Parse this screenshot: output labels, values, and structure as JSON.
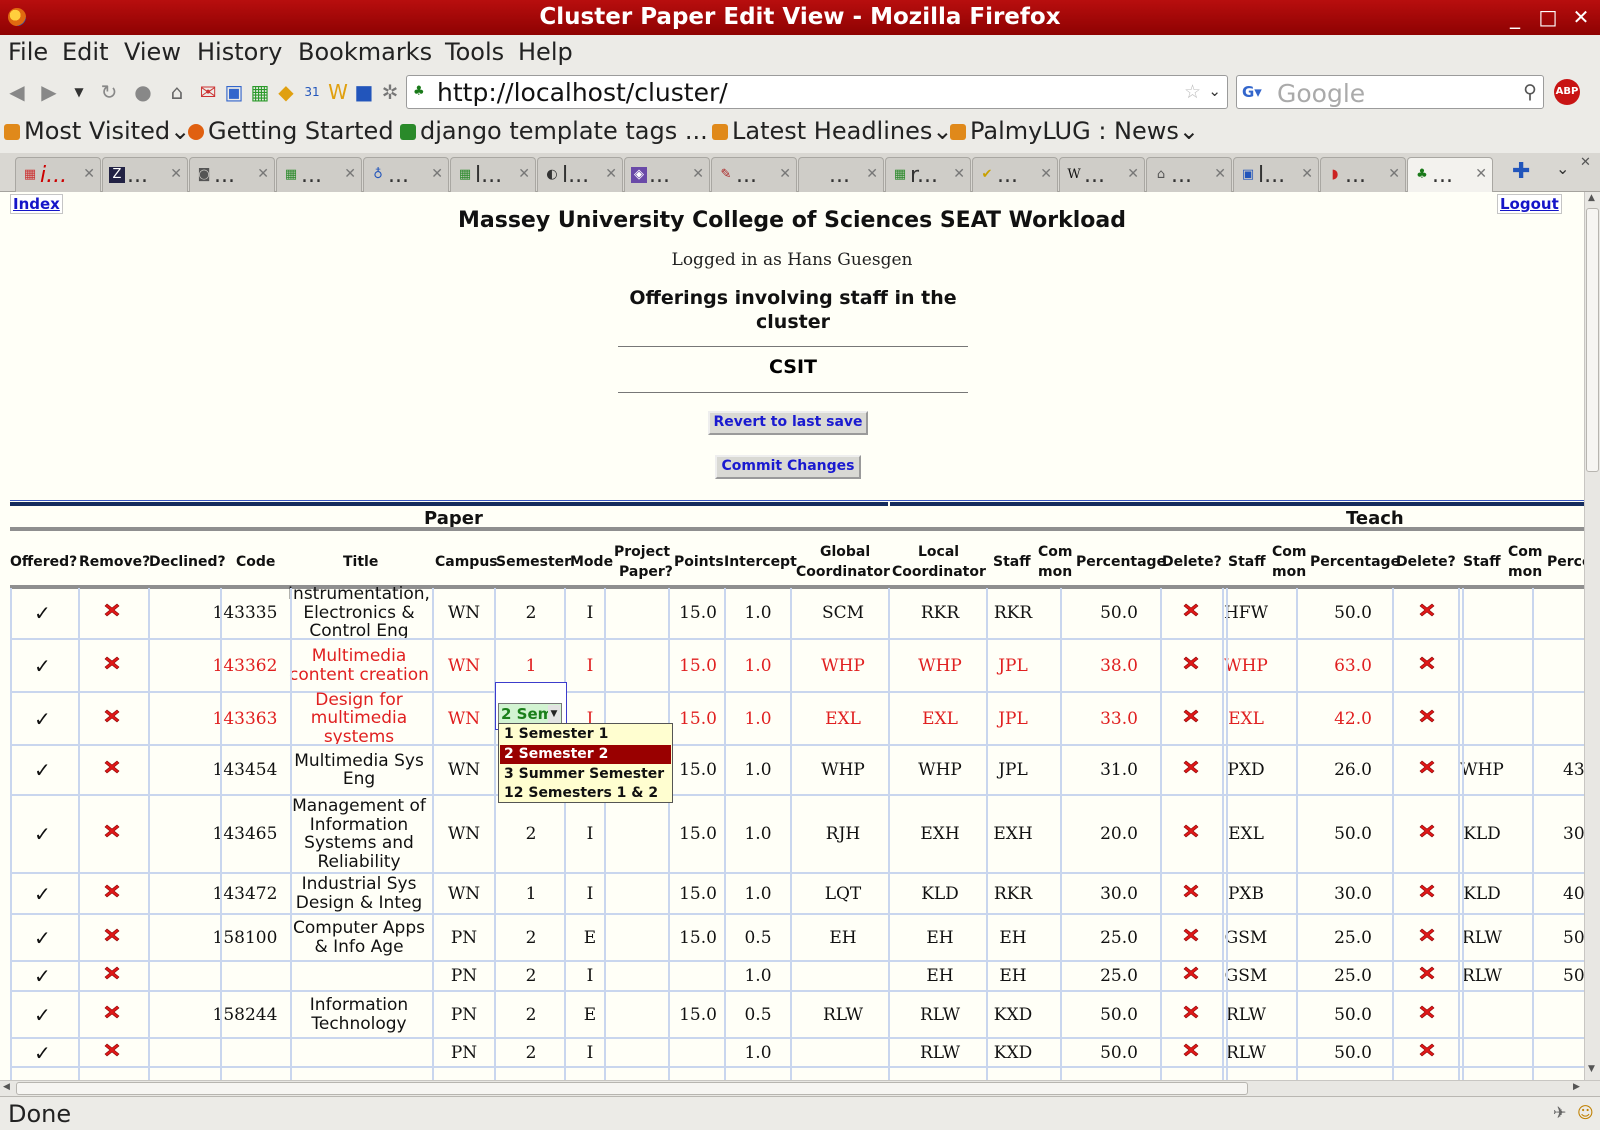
{
  "window": {
    "title": "Cluster Paper Edit View - Mozilla Firefox"
  },
  "menu": [
    "File",
    "Edit",
    "View",
    "History",
    "Bookmarks",
    "Tools",
    "Help"
  ],
  "nav": {
    "url": "http://localhost/cluster/",
    "search_placeholder": "Google",
    "abp": "ABP"
  },
  "bookmarks": [
    "Most Visited",
    "Getting Started",
    "django template tags ...",
    "Latest Headlines",
    "PalmyLUG : News"
  ],
  "tabs": [
    "i...",
    "...",
    "...",
    "...",
    "...",
    "l...",
    "l...",
    "...",
    "...",
    "...",
    "r...",
    "...",
    "...",
    "...",
    "l...",
    "...",
    "..."
  ],
  "page": {
    "index_link": "Index",
    "logout_link": "Logout",
    "heading": "Massey University College of Sciences SEAT Workload",
    "logged_in": "Logged in as Hans Guesgen",
    "offerings_title": "Offerings involving staff in the cluster",
    "cluster": "CSIT",
    "revert_button": "Revert to last save",
    "commit_button": "Commit Changes"
  },
  "table": {
    "groups": {
      "paper": "Paper",
      "teach": "Teach"
    },
    "headers": {
      "offered": "Offered?",
      "remove": "Remove?",
      "declined": "Declined?",
      "code": "Code",
      "title": "Title",
      "campus": "Campus",
      "semester": "Semester",
      "mode": "Mode",
      "project1": "Project",
      "project2": "Paper?",
      "points": "Points",
      "intercept": "Intercept",
      "global1": "Global",
      "global2": "Coordinator",
      "local1": "Local",
      "local2": "Coordinator",
      "staff": "Staff",
      "common1": "Com",
      "common2": "mon",
      "percentage": "Percentage",
      "delete": "Delete?",
      "perc_cut": "Perce"
    },
    "tick": "✓",
    "rows": [
      {
        "code": "143335",
        "title": [
          "Instrumentation,",
          "Electronics &",
          "Control Eng"
        ],
        "campus": "WN",
        "semester": "2",
        "mode": "I",
        "points": "15.0",
        "intercept": "1.0",
        "global": "SCM",
        "local": "RKR",
        "s1": "RKR",
        "p1": "50.0",
        "s2": "HFW",
        "p2": "50.0",
        "s3": "",
        "p3": "",
        "changed": false
      },
      {
        "code": "143362",
        "title": [
          "Multimedia",
          "content creation"
        ],
        "campus": "WN",
        "semester": "1",
        "mode": "I",
        "points": "15.0",
        "intercept": "1.0",
        "global": "WHP",
        "local": "WHP",
        "s1": "JPL",
        "p1": "38.0",
        "s2": "WHP",
        "p2": "63.0",
        "s3": "",
        "p3": "",
        "changed": true
      },
      {
        "code": "143363",
        "title": [
          "Design for",
          "multimedia",
          "systems"
        ],
        "campus": "WN",
        "semester": "",
        "mode": "I",
        "points": "15.0",
        "intercept": "1.0",
        "global": "EXL",
        "local": "EXL",
        "s1": "JPL",
        "p1": "33.0",
        "s2": "EXL",
        "p2": "42.0",
        "s3": "",
        "p3": "",
        "changed": true
      },
      {
        "code": "143454",
        "title": [
          "Multimedia Sys",
          "Eng"
        ],
        "campus": "WN",
        "semester": "",
        "mode": "",
        "points": "15.0",
        "intercept": "1.0",
        "global": "WHP",
        "local": "WHP",
        "s1": "JPL",
        "p1": "31.0",
        "s2": "PXD",
        "p2": "26.0",
        "s3": "WHP",
        "p3": "43",
        "changed": false
      },
      {
        "code": "143465",
        "title": [
          "Management of",
          "Information",
          "Systems and",
          "Reliability"
        ],
        "campus": "WN",
        "semester": "2",
        "mode": "I",
        "points": "15.0",
        "intercept": "1.0",
        "global": "RJH",
        "local": "EXH",
        "s1": "EXH",
        "p1": "20.0",
        "s2": "EXL",
        "p2": "50.0",
        "s3": "KLD",
        "p3": "30",
        "changed": false
      },
      {
        "code": "143472",
        "title": [
          "Industrial Sys",
          "Design & Integ"
        ],
        "campus": "WN",
        "semester": "1",
        "mode": "I",
        "points": "15.0",
        "intercept": "1.0",
        "global": "LQT",
        "local": "KLD",
        "s1": "RKR",
        "p1": "30.0",
        "s2": "PXB",
        "p2": "30.0",
        "s3": "KLD",
        "p3": "40",
        "changed": false
      },
      {
        "code": "158100",
        "title": [
          "Computer Apps",
          "& Info Age"
        ],
        "campus": "PN",
        "semester": "2",
        "mode": "E",
        "points": "15.0",
        "intercept": "0.5",
        "global": "EH",
        "local": "EH",
        "s1": "EH",
        "p1": "25.0",
        "s2": "GSM",
        "p2": "25.0",
        "s3": "RLW",
        "p3": "50",
        "changed": false
      },
      {
        "code": "",
        "title": [],
        "campus": "PN",
        "semester": "2",
        "mode": "I",
        "points": "",
        "intercept": "1.0",
        "global": "",
        "local": "EH",
        "s1": "EH",
        "p1": "25.0",
        "s2": "GSM",
        "p2": "25.0",
        "s3": "RLW",
        "p3": "50",
        "changed": false
      },
      {
        "code": "158244",
        "title": [
          "Information",
          "Technology"
        ],
        "campus": "PN",
        "semester": "2",
        "mode": "E",
        "points": "15.0",
        "intercept": "0.5",
        "global": "RLW",
        "local": "RLW",
        "s1": "KXD",
        "p1": "50.0",
        "s2": "RLW",
        "p2": "50.0",
        "s3": "",
        "p3": "",
        "changed": false
      },
      {
        "code": "",
        "title": [],
        "campus": "PN",
        "semester": "2",
        "mode": "I",
        "points": "",
        "intercept": "1.0",
        "global": "",
        "local": "RLW",
        "s1": "KXD",
        "p1": "50.0",
        "s2": "RLW",
        "p2": "50.0",
        "s3": "",
        "p3": "",
        "changed": false
      }
    ]
  },
  "semester_select": {
    "value": "2 Sem",
    "options": [
      "1 Semester 1",
      "2 Semester 2",
      "3 Summer Semester",
      "12 Semesters 1 & 2"
    ],
    "highlighted": "2 Semester 2"
  },
  "status": "Done"
}
